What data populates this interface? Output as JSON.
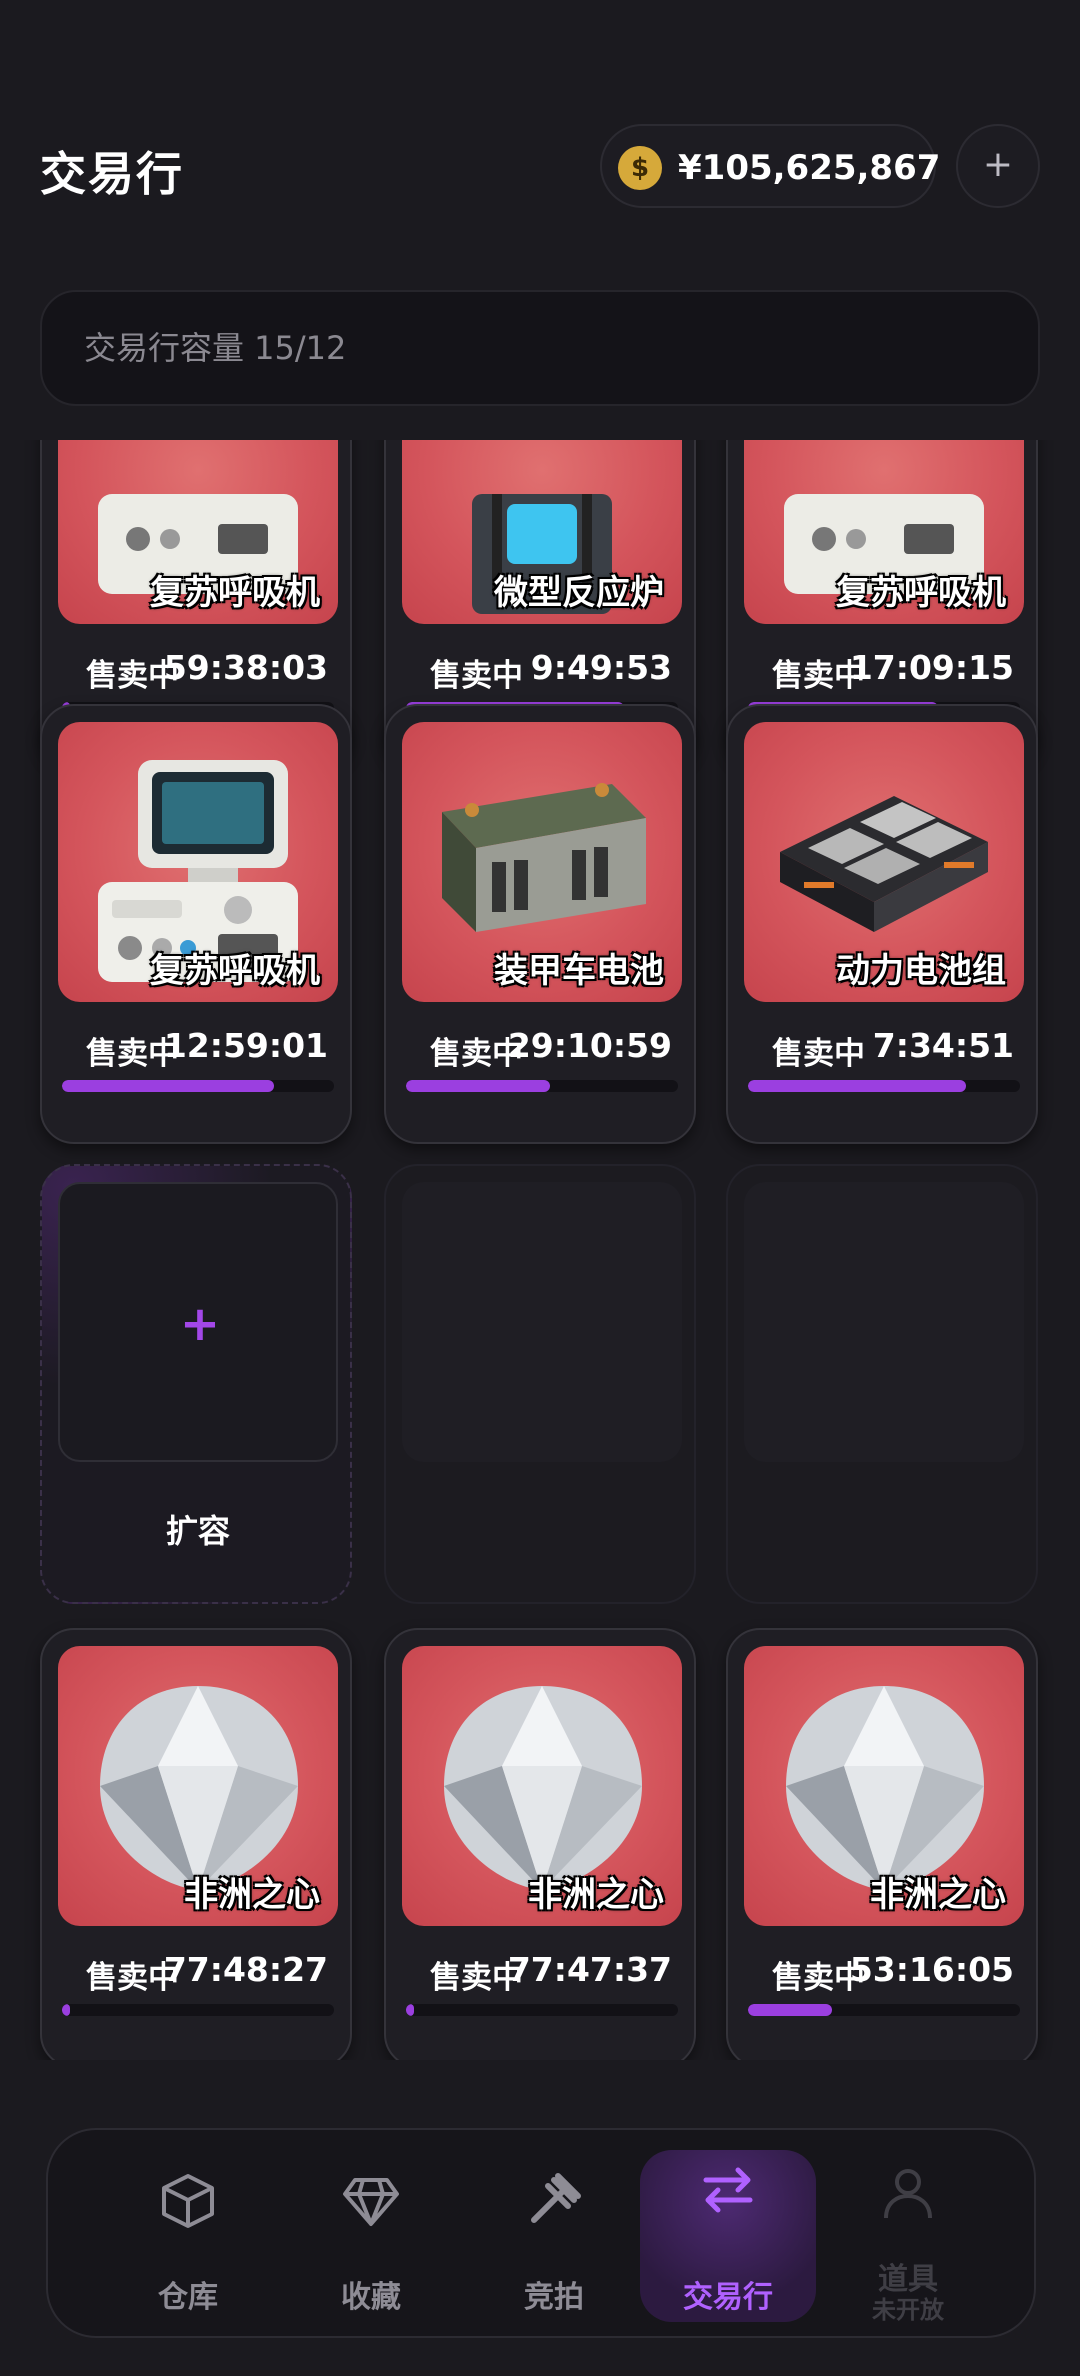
{
  "header": {
    "title": "交易行",
    "balance": "¥105,625,867",
    "coin_symbol": "$",
    "add_label": "+"
  },
  "capacity_label": "交易行容量 15/12",
  "listings_row1": [
    {
      "name": "复苏呼吸机",
      "status": "售卖中",
      "timer": "59:38:03",
      "progress": 0.03
    },
    {
      "name": "微型反应炉",
      "status": "售卖中",
      "timer": "9:49:53",
      "progress": 0.8
    },
    {
      "name": "复苏呼吸机",
      "status": "售卖中",
      "timer": "17:09:15",
      "progress": 0.7
    }
  ],
  "listings_row2": [
    {
      "name": "复苏呼吸机",
      "status": "售卖中",
      "timer": "12:59:01",
      "progress": 0.78,
      "icon": "ventilator-icon"
    },
    {
      "name": "装甲车电池",
      "status": "售卖中",
      "timer": "29:10:59",
      "progress": 0.53,
      "icon": "armored-battery-icon"
    },
    {
      "name": "动力电池组",
      "status": "售卖中",
      "timer": "7:34:51",
      "progress": 0.8,
      "icon": "power-battery-pack-icon"
    }
  ],
  "expand_slot": {
    "plus": "+",
    "label": "扩容"
  },
  "listings_row4": [
    {
      "name": "非洲之心",
      "status": "售卖中",
      "timer": "77:48:27",
      "progress": 0.03,
      "icon": "diamond-gem-icon"
    },
    {
      "name": "非洲之心",
      "status": "售卖中",
      "timer": "77:47:37",
      "progress": 0.03,
      "icon": "diamond-gem-icon"
    },
    {
      "name": "非洲之心",
      "status": "售卖中",
      "timer": "53:16:05",
      "progress": 0.31,
      "icon": "diamond-gem-icon"
    }
  ],
  "nav": [
    {
      "label": "仓库",
      "icon": "box-icon"
    },
    {
      "label": "收藏",
      "icon": "diamond-icon"
    },
    {
      "label": "竞拍",
      "icon": "gavel-icon"
    },
    {
      "label": "交易行",
      "icon": "swap-arrows-icon",
      "active": true
    },
    {
      "label": "道具",
      "sub": "未开放",
      "icon": "user-icon",
      "disabled": true
    }
  ],
  "colors": {
    "accent": "#9b3fe0",
    "card_bg": "#d4555c",
    "page_bg": "#1b1a1f"
  }
}
